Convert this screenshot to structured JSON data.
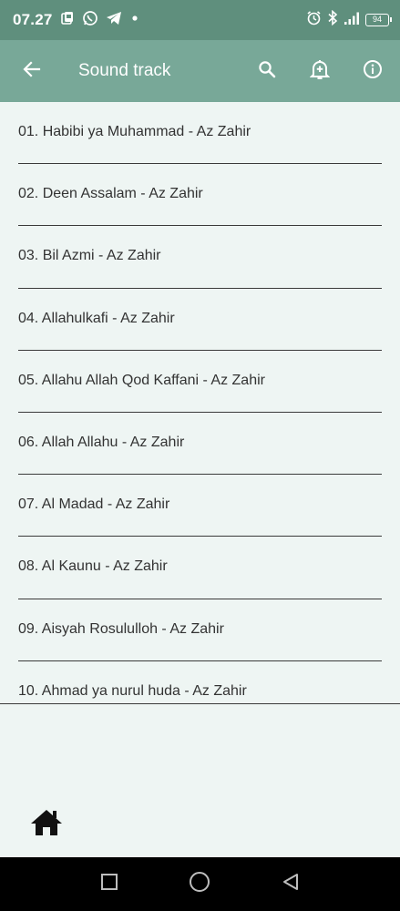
{
  "status_bar": {
    "time": "07.27",
    "battery": "94",
    "icons": [
      "gallery-icon",
      "whatsapp-icon",
      "telegram-icon",
      "dot-icon",
      "alarm-icon",
      "bluetooth-icon",
      "signal-icon",
      "battery-icon"
    ]
  },
  "app_bar": {
    "title": "Sound track",
    "icons": [
      "back-arrow-icon",
      "search-icon",
      "bell-add-icon",
      "info-icon"
    ]
  },
  "tracks": [
    "01. Habibi ya Muhammad - Az Zahir",
    "02. Deen Assalam - Az Zahir",
    "03. Bil Azmi - Az Zahir",
    "04. Allahulkafi - Az Zahir",
    "05. Allahu Allah Qod Kaffani - Az Zahir",
    "06. Allah Allahu - Az Zahir",
    "07. Al Madad - Az Zahir",
    "08. Al Kaunu - Az Zahir",
    "09. Aisyah Rosululloh - Az Zahir",
    "10. Ahmad ya nurul huda - Az Zahir"
  ],
  "bottom": {
    "icon": "home-icon"
  },
  "nav": {
    "icons": [
      "recents-square-icon",
      "home-circle-icon",
      "back-triangle-icon"
    ]
  },
  "colors": {
    "status_bar": "#5f8f7d",
    "app_bar": "#78a898",
    "background": "#eef5f3"
  }
}
